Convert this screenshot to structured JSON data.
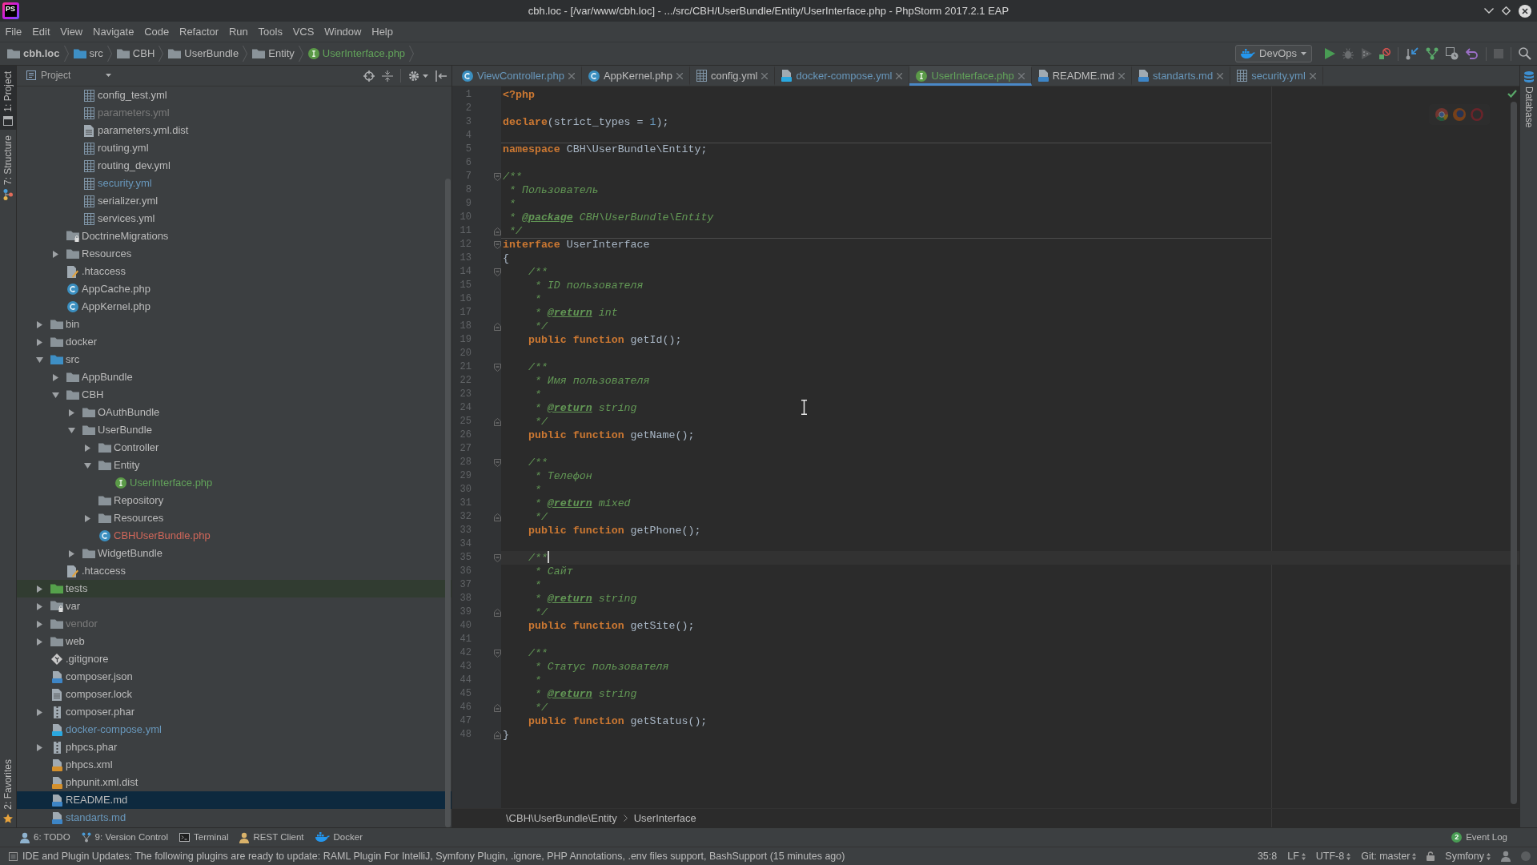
{
  "window": {
    "title": "cbh.loc - [/var/www/cbh.loc] - .../src/CBH/UserBundle/Entity/UserInterface.php - PhpStorm 2017.2.1 EAP",
    "logo": "PS"
  },
  "menu": [
    "File",
    "Edit",
    "View",
    "Navigate",
    "Code",
    "Refactor",
    "Run",
    "Tools",
    "VCS",
    "Window",
    "Help"
  ],
  "navigation_bar": {
    "path": [
      {
        "label": "cbh.loc",
        "kind": "project"
      },
      {
        "label": "src",
        "kind": "source-folder"
      },
      {
        "label": "CBH",
        "kind": "folder"
      },
      {
        "label": "UserBundle",
        "kind": "folder"
      },
      {
        "label": "Entity",
        "kind": "folder"
      },
      {
        "label": "UserInterface.php",
        "kind": "php-interface",
        "color": "#62a35a"
      }
    ],
    "run_configuration": "DevOps"
  },
  "left_tool_strip": {
    "top": [
      {
        "label": "1: Project",
        "selected": true
      },
      {
        "label": "7: Structure",
        "selected": false
      }
    ],
    "bottom": [
      {
        "label": "2: Favorites",
        "selected": false
      }
    ]
  },
  "project_panel": {
    "title": "Project",
    "tree": [
      {
        "children": [
          {
            "children": [
              {
                "label": "config_test.yml",
                "kind": "yml",
                "selected": false
              },
              {
                "label": "parameters.yml",
                "kind": "yml",
                "color": "#7b7b7b",
                "selected": false
              },
              {
                "label": "parameters.yml.dist",
                "kind": "text",
                "selected": false
              },
              {
                "label": "routing.yml",
                "kind": "yml",
                "selected": false
              },
              {
                "label": "routing_dev.yml",
                "kind": "yml",
                "selected": false
              },
              {
                "label": "security.yml",
                "kind": "yml",
                "color": "#6897bb",
                "selected": false
              },
              {
                "label": "serializer.yml",
                "kind": "yml",
                "selected": false
              },
              {
                "label": "services.yml",
                "kind": "yml",
                "selected": false
              }
            ]
          },
          {
            "label": "DoctrineMigrations",
            "kind": "locked-folder",
            "selected": false
          },
          {
            "label": "Resources",
            "kind": "folder",
            "expanded": false,
            "selected": false
          },
          {
            "label": ".htaccess",
            "kind": "htaccess",
            "selected": false
          },
          {
            "label": "AppCache.php",
            "kind": "php-class",
            "selected": false
          },
          {
            "label": "AppKernel.php",
            "kind": "php-class",
            "selected": false
          }
        ]
      },
      {
        "label": "bin",
        "kind": "folder",
        "expanded": false,
        "selected": false
      },
      {
        "label": "docker",
        "kind": "folder",
        "expanded": false,
        "selected": false
      },
      {
        "label": "src",
        "kind": "source-folder",
        "expanded": true,
        "selected": false,
        "children": [
          {
            "label": "AppBundle",
            "kind": "folder",
            "expanded": false,
            "selected": false
          },
          {
            "label": "CBH",
            "kind": "folder",
            "expanded": true,
            "selected": false,
            "children": [
              {
                "label": "OAuthBundle",
                "kind": "folder",
                "expanded": false,
                "selected": false
              },
              {
                "label": "UserBundle",
                "kind": "folder",
                "expanded": true,
                "selected": false,
                "children": [
                  {
                    "label": "Controller",
                    "kind": "folder",
                    "expanded": false,
                    "selected": false
                  },
                  {
                    "label": "Entity",
                    "kind": "folder",
                    "expanded": true,
                    "selected": false,
                    "children": [
                      {
                        "label": "UserInterface.php",
                        "kind": "php-interface",
                        "color": "#62a35a",
                        "selected": false
                      }
                    ]
                  },
                  {
                    "label": "Repository",
                    "kind": "folder",
                    "selected": false
                  },
                  {
                    "label": "Resources",
                    "kind": "folder",
                    "expanded": false,
                    "selected": false
                  },
                  {
                    "label": "CBHUserBundle.php",
                    "kind": "php-class",
                    "color": "#d1675a",
                    "selected": false
                  }
                ]
              },
              {
                "label": "WidgetBundle",
                "kind": "folder",
                "expanded": false,
                "selected": false
              }
            ]
          },
          {
            "label": ".htaccess",
            "kind": "htaccess",
            "selected": false
          }
        ]
      },
      {
        "label": "tests",
        "kind": "test-folder",
        "expanded": false,
        "selected": false
      },
      {
        "label": "var",
        "kind": "locked-folder",
        "expanded": false,
        "selected": false
      },
      {
        "label": "vendor",
        "kind": "folder",
        "color": "#7b7b7b",
        "expanded": false,
        "selected": false
      },
      {
        "label": "web",
        "kind": "folder",
        "expanded": false,
        "selected": false
      },
      {
        "label": ".gitignore",
        "kind": "git",
        "selected": false
      },
      {
        "label": "composer.json",
        "kind": "json",
        "selected": false
      },
      {
        "label": "composer.lock",
        "kind": "text",
        "selected": false
      },
      {
        "label": "composer.phar",
        "kind": "archive",
        "expanded": false,
        "selected": false
      },
      {
        "label": "docker-compose.yml",
        "kind": "compose",
        "color": "#6897bb",
        "selected": false
      },
      {
        "label": "phpcs.phar",
        "kind": "archive",
        "expanded": false,
        "selected": false
      },
      {
        "label": "phpcs.xml",
        "kind": "xml",
        "selected": false
      },
      {
        "label": "phpunit.xml.dist",
        "kind": "xml",
        "selected": false
      },
      {
        "label": "README.md",
        "kind": "markdown",
        "selected": true
      },
      {
        "label": "standarts.md",
        "kind": "markdown",
        "color": "#6897bb",
        "selected": false
      }
    ]
  },
  "editor": {
    "tabs": [
      {
        "label": "ViewController.php",
        "kind": "php-class",
        "color": "#6897bb",
        "selected": false
      },
      {
        "label": "AppKernel.php",
        "kind": "php-class",
        "selected": false
      },
      {
        "label": "config.yml",
        "kind": "yml",
        "selected": false
      },
      {
        "label": "docker-compose.yml",
        "kind": "compose",
        "color": "#6897bb",
        "selected": false
      },
      {
        "label": "UserInterface.php",
        "kind": "php-interface",
        "color": "#62a35a",
        "selected": true
      },
      {
        "label": "README.md",
        "kind": "markdown",
        "selected": false
      },
      {
        "label": "standarts.md",
        "kind": "markdown",
        "color": "#6897bb",
        "selected": false
      },
      {
        "label": "security.yml",
        "kind": "yml",
        "color": "#6897bb",
        "selected": false
      }
    ],
    "lines": [
      {
        "number": "1",
        "tokens": [
          {
            "kind": "keyword",
            "text": "<?php"
          }
        ]
      },
      {
        "number": "2"
      },
      {
        "number": "3",
        "tokens": [
          {
            "kind": "keyword",
            "text": "declare"
          },
          {
            "kind": "plain",
            "text": "(strict_types = "
          },
          {
            "kind": "number",
            "text": "1"
          },
          {
            "kind": "plain",
            "text": ");"
          }
        ]
      },
      {
        "number": "4"
      },
      {
        "number": "5",
        "separator_above": true,
        "tokens": [
          {
            "kind": "keyword",
            "text": "namespace"
          },
          {
            "kind": "plain",
            "text": " CBH\\UserBundle\\Entity;"
          }
        ]
      },
      {
        "number": "6"
      },
      {
        "number": "7",
        "fold_start": true,
        "tokens": [
          {
            "kind": "doc",
            "text": "/**"
          }
        ]
      },
      {
        "number": "8",
        "tokens": [
          {
            "kind": "doc",
            "text": " * Пользователь"
          }
        ]
      },
      {
        "number": "9",
        "tokens": [
          {
            "kind": "doc",
            "text": " *"
          }
        ]
      },
      {
        "number": "10",
        "tokens": [
          {
            "kind": "doc",
            "text": " * "
          },
          {
            "kind": "doc-tag",
            "text": "@package"
          },
          {
            "kind": "doc",
            "text": " CBH\\UserBundle\\Entity"
          }
        ]
      },
      {
        "number": "11",
        "fold_end": true,
        "tokens": [
          {
            "kind": "doc",
            "text": " */"
          }
        ]
      },
      {
        "number": "12",
        "fold_start": true,
        "separator_above": true,
        "tokens": [
          {
            "kind": "keyword",
            "text": "interface"
          },
          {
            "kind": "plain",
            "text": " UserInterface"
          }
        ]
      },
      {
        "number": "13",
        "tokens": [
          {
            "kind": "plain",
            "text": "{"
          }
        ]
      },
      {
        "number": "14",
        "fold_start": true,
        "tokens": [
          {
            "kind": "doc",
            "text": "    /**"
          }
        ]
      },
      {
        "number": "15",
        "tokens": [
          {
            "kind": "doc",
            "text": "     * ID пользователя"
          }
        ]
      },
      {
        "number": "16",
        "tokens": [
          {
            "kind": "doc",
            "text": "     *"
          }
        ]
      },
      {
        "number": "17",
        "tokens": [
          {
            "kind": "doc",
            "text": "     * "
          },
          {
            "kind": "doc-tag",
            "text": "@return"
          },
          {
            "kind": "doc",
            "text": " int"
          }
        ]
      },
      {
        "number": "18",
        "fold_end": true,
        "tokens": [
          {
            "kind": "doc",
            "text": "     */"
          }
        ]
      },
      {
        "number": "19",
        "tokens": [
          {
            "kind": "keyword",
            "text": "    public function"
          },
          {
            "kind": "plain",
            "text": " getId();"
          }
        ]
      },
      {
        "number": "20"
      },
      {
        "number": "21",
        "fold_start": true,
        "tokens": [
          {
            "kind": "doc",
            "text": "    /**"
          }
        ]
      },
      {
        "number": "22",
        "tokens": [
          {
            "kind": "doc",
            "text": "     * Имя пользователя"
          }
        ]
      },
      {
        "number": "23",
        "tokens": [
          {
            "kind": "doc",
            "text": "     *"
          }
        ]
      },
      {
        "number": "24",
        "tokens": [
          {
            "kind": "doc",
            "text": "     * "
          },
          {
            "kind": "doc-tag",
            "text": "@return"
          },
          {
            "kind": "doc",
            "text": " string"
          }
        ]
      },
      {
        "number": "25",
        "fold_end": true,
        "tokens": [
          {
            "kind": "doc",
            "text": "     */"
          }
        ]
      },
      {
        "number": "26",
        "tokens": [
          {
            "kind": "keyword",
            "text": "    public function"
          },
          {
            "kind": "plain",
            "text": " getName();"
          }
        ]
      },
      {
        "number": "27"
      },
      {
        "number": "28",
        "fold_start": true,
        "tokens": [
          {
            "kind": "doc",
            "text": "    /**"
          }
        ]
      },
      {
        "number": "29",
        "tokens": [
          {
            "kind": "doc",
            "text": "     * Телефон"
          }
        ]
      },
      {
        "number": "30",
        "tokens": [
          {
            "kind": "doc",
            "text": "     *"
          }
        ]
      },
      {
        "number": "31",
        "tokens": [
          {
            "kind": "doc",
            "text": "     * "
          },
          {
            "kind": "doc-tag",
            "text": "@return"
          },
          {
            "kind": "doc",
            "text": " mixed"
          }
        ]
      },
      {
        "number": "32",
        "fold_end": true,
        "tokens": [
          {
            "kind": "doc",
            "text": "     */"
          }
        ]
      },
      {
        "number": "33",
        "tokens": [
          {
            "kind": "keyword",
            "text": "    public function"
          },
          {
            "kind": "plain",
            "text": " getPhone();"
          }
        ]
      },
      {
        "number": "34"
      },
      {
        "number": "35",
        "fold_start": true,
        "caret": true,
        "tokens": [
          {
            "kind": "doc",
            "text": "    /**"
          }
        ]
      },
      {
        "number": "36",
        "tokens": [
          {
            "kind": "doc",
            "text": "     * Сайт"
          }
        ]
      },
      {
        "number": "37",
        "tokens": [
          {
            "kind": "doc",
            "text": "     *"
          }
        ]
      },
      {
        "number": "38",
        "tokens": [
          {
            "kind": "doc",
            "text": "     * "
          },
          {
            "kind": "doc-tag",
            "text": "@return"
          },
          {
            "kind": "doc",
            "text": " string"
          }
        ]
      },
      {
        "number": "39",
        "fold_end": true,
        "tokens": [
          {
            "kind": "doc",
            "text": "     */"
          }
        ]
      },
      {
        "number": "40",
        "tokens": [
          {
            "kind": "keyword",
            "text": "    public function"
          },
          {
            "kind": "plain",
            "text": " getSite();"
          }
        ]
      },
      {
        "number": "41"
      },
      {
        "number": "42",
        "fold_start": true,
        "tokens": [
          {
            "kind": "doc",
            "text": "    /**"
          }
        ]
      },
      {
        "number": "43",
        "tokens": [
          {
            "kind": "doc",
            "text": "     * Статус пользователя"
          }
        ]
      },
      {
        "number": "44",
        "tokens": [
          {
            "kind": "doc",
            "text": "     *"
          }
        ]
      },
      {
        "number": "45",
        "tokens": [
          {
            "kind": "doc",
            "text": "     * "
          },
          {
            "kind": "doc-tag",
            "text": "@return"
          },
          {
            "kind": "doc",
            "text": " string"
          }
        ]
      },
      {
        "number": "46",
        "fold_end": true,
        "tokens": [
          {
            "kind": "doc",
            "text": "     */"
          }
        ]
      },
      {
        "number": "47",
        "tokens": [
          {
            "kind": "keyword",
            "text": "    public function"
          },
          {
            "kind": "plain",
            "text": " getStatus();"
          }
        ]
      },
      {
        "number": "48",
        "fold_end": true,
        "tokens": [
          {
            "kind": "plain",
            "text": "}"
          }
        ]
      }
    ],
    "breadcrumb": [
      "\\CBH\\UserBundle\\Entity",
      "UserInterface"
    ]
  },
  "right_tool_strip": [
    {
      "label": "Database",
      "selected": false
    }
  ],
  "tool_window_bar": {
    "items": [
      "6: TODO",
      "9: Version Control",
      "Terminal",
      "REST Client",
      "Docker"
    ],
    "event_log": {
      "label": "Event Log",
      "count": "2"
    }
  },
  "status_bar": {
    "message": "IDE and Plugin Updates: The following plugins are ready to update: RAML Plugin For IntelliJ, Symfony Plugin, .ignore, PHP Annotations, .env files support, BashSupport (15 minutes ago)",
    "widgets": [
      {
        "text": "35:8",
        "dropdown": false
      },
      {
        "text": "LF",
        "dropdown": true
      },
      {
        "text": "UTF-8",
        "dropdown": true
      },
      {
        "text": "Git: master",
        "dropdown": true
      },
      {
        "text": "Symfony",
        "dropdown": true
      }
    ]
  }
}
